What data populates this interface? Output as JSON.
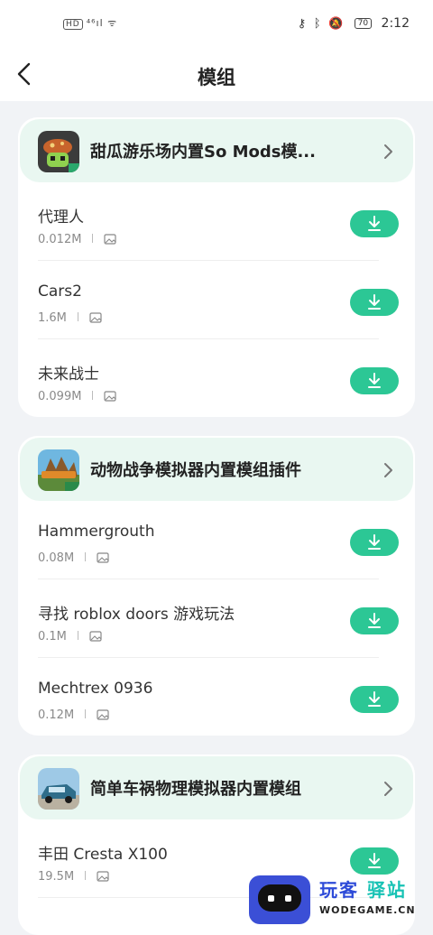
{
  "status_bar": {
    "left_text": "⁴⁶ıl ᯤ",
    "hd": "HD",
    "battery": "70",
    "time": "2:12"
  },
  "header": {
    "title": "模组"
  },
  "icons": {
    "back": "chevron-left-icon",
    "download": "download-icon",
    "image": "image-icon",
    "more": "chevron-right-icon"
  },
  "colors": {
    "accent": "#2cc795",
    "card_head_bg": "#e9f7f1",
    "page_bg": "#f1f3f6"
  },
  "sections": [
    {
      "title": "甜瓜游乐场内置So Mods模...",
      "items": [
        {
          "name": "代理人",
          "size": "0.012M"
        },
        {
          "name": "Cars2",
          "size": "1.6M"
        },
        {
          "name": "未来战士",
          "size": "0.099M"
        }
      ]
    },
    {
      "title": "动物战争模拟器内置模组插件",
      "items": [
        {
          "name": "Hammergrouth",
          "size": "0.08M"
        },
        {
          "name": "寻找 roblox doors 游戏玩法",
          "size": "0.1M"
        },
        {
          "name": "Mechtrex 0936",
          "size": "0.12M"
        }
      ]
    },
    {
      "title": "简单车祸物理模拟器内置模组",
      "items": [
        {
          "name": "丰田 Cresta X100",
          "size": "19.5M"
        }
      ]
    }
  ],
  "watermark": {
    "name_a": "玩客",
    "name_b": "驿站",
    "url": "WODEGAME.CN"
  }
}
